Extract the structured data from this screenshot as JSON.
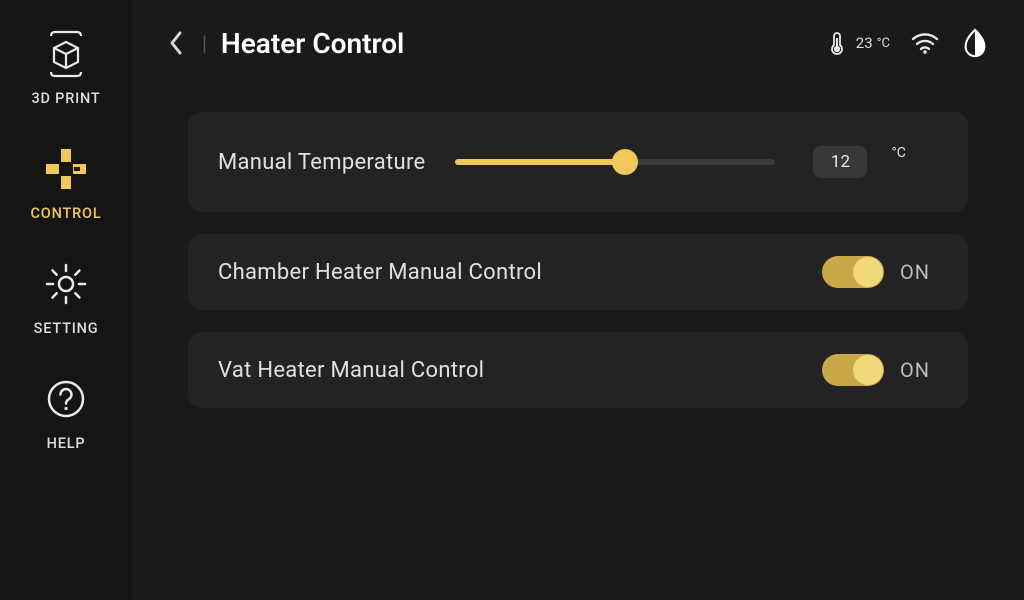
{
  "sidebar": {
    "items": [
      {
        "label": "3D PRINT"
      },
      {
        "label": "CONTROL"
      },
      {
        "label": "SETTING"
      },
      {
        "label": "HELP"
      }
    ]
  },
  "header": {
    "title": "Heater Control",
    "temperature_value": "23",
    "temperature_unit": "°C"
  },
  "controls": {
    "manual_temp": {
      "label": "Manual Temperature",
      "value": "12",
      "unit": "°C"
    },
    "chamber": {
      "label": "Chamber Heater Manual Control",
      "state": "ON"
    },
    "vat": {
      "label": "Vat Heater Manual Control",
      "state": "ON"
    }
  }
}
